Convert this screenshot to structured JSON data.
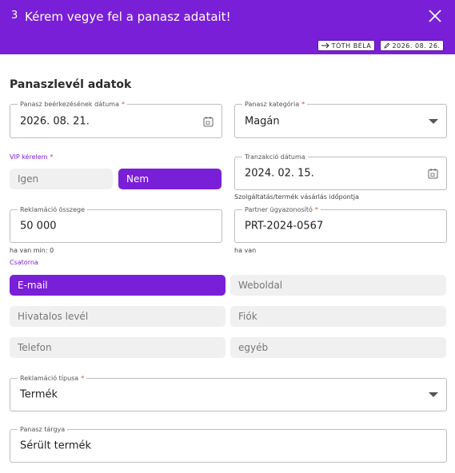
{
  "header": {
    "step": "3",
    "title": "Kérem vegye fel a panasz adatait!",
    "user_chip": "TÓTH BÉLA",
    "date_chip": "2026. 08. 26."
  },
  "section": {
    "title": "Panaszlevél adatok"
  },
  "fields": {
    "received_date": {
      "label": "Panasz beérkezésének dátuma",
      "value": "2026. 08. 21."
    },
    "category": {
      "label": "Panasz kategória",
      "value": "Magán"
    },
    "vip": {
      "label": "VIP kérelem",
      "options": [
        "Igen",
        "Nem"
      ],
      "selected": "Nem"
    },
    "transaction_date": {
      "label": "Tranzakció dátuma",
      "value": "2024. 02. 15.",
      "helper": "Szolgáltatás/termék vásárlás időpontja"
    },
    "amount": {
      "label": "Reklamáció összege",
      "value": "50 000",
      "helper": "ha van min: 0"
    },
    "partner_id": {
      "label": "Partner ügyazonosító",
      "value": "PRT-2024-0567",
      "helper": "ha van"
    },
    "channel": {
      "label": "Csatorna",
      "options": [
        "E-mail",
        "Weboldal",
        "Hivatalos levél",
        "Fiók",
        "Telefon",
        "egyéb"
      ],
      "selected": "E-mail"
    },
    "complaint_type": {
      "label": "Reklamáció típusa",
      "value": "Termék"
    },
    "subject": {
      "label": "Panasz tárgya",
      "value": "Sérült termék"
    }
  },
  "required_mark": "*",
  "colors": {
    "accent": "#7a1fd8",
    "required": "#e0453a"
  }
}
